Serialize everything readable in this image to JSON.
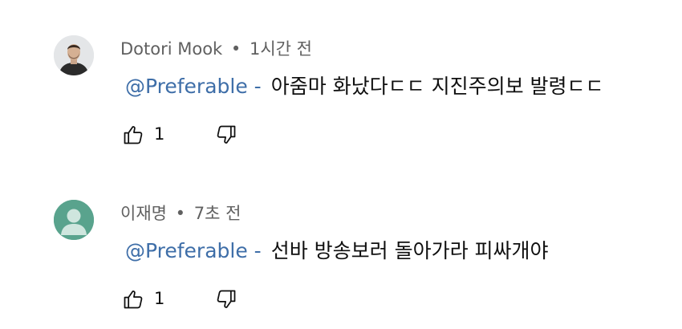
{
  "comments": [
    {
      "author": "Dotori Mook",
      "separator": "•",
      "time": "1시간 전",
      "mention": "@Preferable -",
      "text": "아줌마 화났다ㄷㄷ 지진주의보 발령ㄷㄷ",
      "like_count": "1",
      "avatar": "user-photo-avatar"
    },
    {
      "author": "이재명",
      "separator": "•",
      "time": "7초 전",
      "mention": "@Preferable -",
      "text": "선바 방송보러 돌아가라 피싸개야",
      "like_count": "1",
      "avatar": "default-user-avatar"
    }
  ],
  "colors": {
    "mention": "#3e6ea8",
    "meta": "#606060",
    "default_avatar_bg": "#59a38d"
  },
  "icons": {
    "like": "thumbs-up-icon",
    "dislike": "thumbs-down-icon"
  }
}
